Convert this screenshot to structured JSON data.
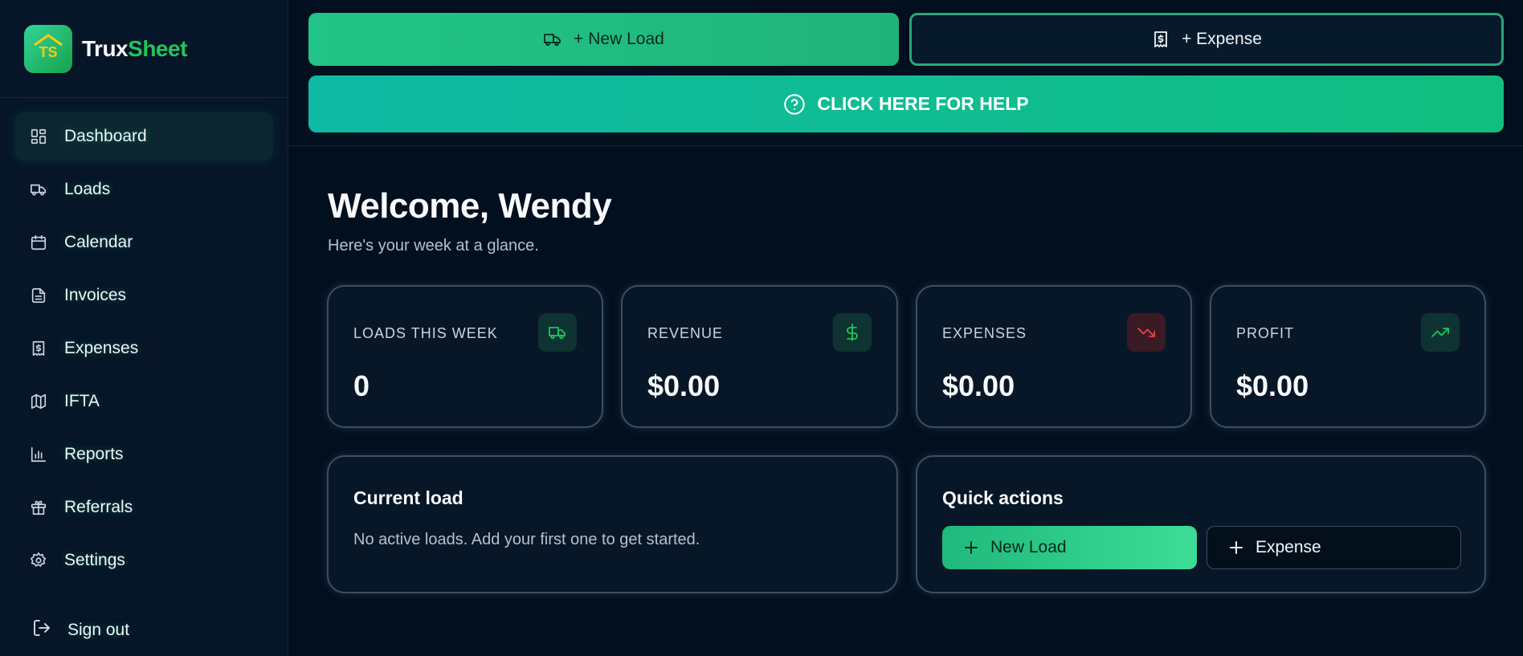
{
  "brand": {
    "name_part1": "Trux",
    "name_part2": "Sheet",
    "logo_text": "TS"
  },
  "sidebar": {
    "items": [
      {
        "label": "Dashboard",
        "icon": "dashboard-icon",
        "active": true
      },
      {
        "label": "Loads",
        "icon": "truck-icon"
      },
      {
        "label": "Calendar",
        "icon": "calendar-icon"
      },
      {
        "label": "Invoices",
        "icon": "invoice-icon"
      },
      {
        "label": "Expenses",
        "icon": "receipt-icon"
      },
      {
        "label": "IFTA",
        "icon": "map-icon"
      },
      {
        "label": "Reports",
        "icon": "bar-chart-icon"
      },
      {
        "label": "Referrals",
        "icon": "gift-icon"
      },
      {
        "label": "Settings",
        "icon": "gear-icon"
      }
    ],
    "signout_label": "Sign out"
  },
  "topbar": {
    "new_load_label": "+ New Load",
    "expense_label": "+ Expense",
    "help_label": "CLICK HERE FOR HELP"
  },
  "main": {
    "welcome": "Welcome, Wendy",
    "subtitle": "Here's your week at a glance."
  },
  "stats": [
    {
      "title": "LOADS THIS WEEK",
      "value": "0",
      "icon": "truck-icon"
    },
    {
      "title": "REVENUE",
      "value": "$0.00",
      "icon": "dollar-icon"
    },
    {
      "title": "EXPENSES",
      "value": "$0.00",
      "icon": "trend-down-icon"
    },
    {
      "title": "PROFIT",
      "value": "$0.00",
      "icon": "trend-up-icon"
    }
  ],
  "current_load": {
    "title": "Current load",
    "text": "No active loads. Add your first one to get started."
  },
  "quick_actions": {
    "title": "Quick actions",
    "new_load_label": "New Load",
    "expense_label": "Expense"
  },
  "colors": {
    "accent": "#22c55e",
    "background": "#020f1f",
    "sidebar": "#061527",
    "danger": "#ef4444"
  }
}
